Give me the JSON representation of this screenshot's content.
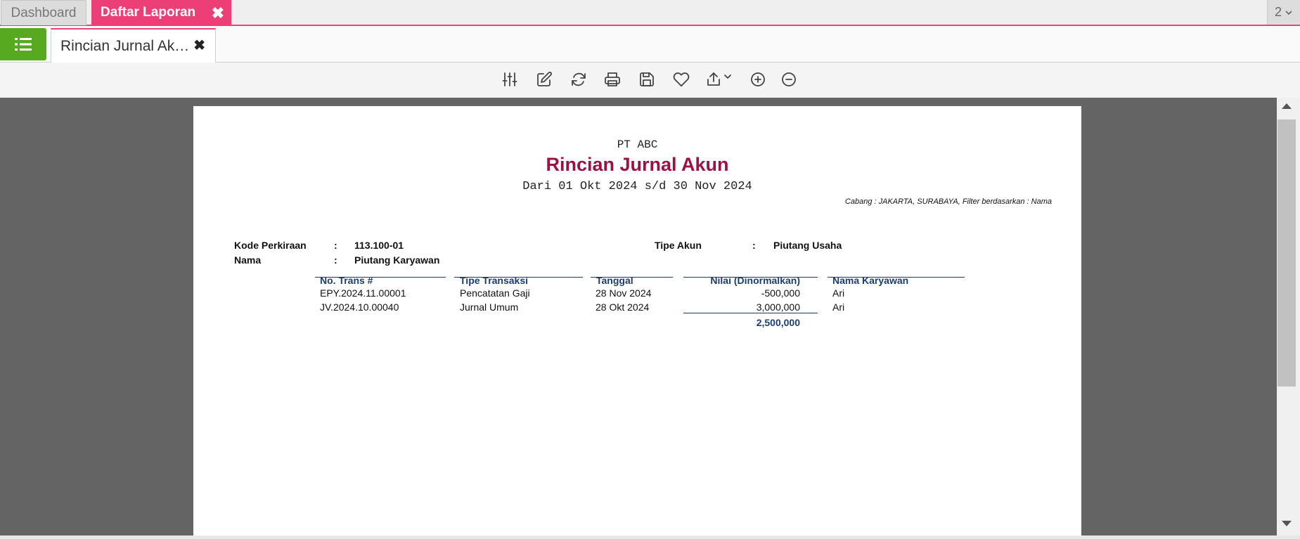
{
  "tabs": {
    "dashboard": "Dashboard",
    "daftar_laporan": "Daftar Laporan",
    "close_glyph": "✖",
    "page_count": "2"
  },
  "subtabs": {
    "rincian": "Rincian Jurnal Ak…",
    "close_glyph": "✖"
  },
  "toolbar_icons": [
    "sliders-icon",
    "edit-icon",
    "refresh-icon",
    "print-icon",
    "save-icon",
    "favorite-icon",
    "export-icon",
    "zoom-in-icon",
    "zoom-out-icon"
  ],
  "report": {
    "company": "PT ABC",
    "title": "Rincian Jurnal Akun",
    "period": "Dari 01 Okt 2024 s/d 30 Nov 2024",
    "filter": "Cabang : JAKARTA, SURABAYA, Filter berdasarkan : Nama",
    "kode_label": "Kode Perkiraan",
    "kode_value": "113.100-01",
    "nama_label": "Nama",
    "nama_value": "Piutang Karyawan",
    "tipe_label": "Tipe Akun",
    "tipe_value": "Piutang Usaha",
    "colon": ":",
    "columns": [
      "No. Trans #",
      "Tipe Transaksi",
      "Tanggal",
      "Nilai (Dinormalkan)",
      "Nama Karyawan"
    ],
    "rows": [
      {
        "no": "EPY.2024.11.00001",
        "tipe": "Pencatatan Gaji",
        "tanggal": "28 Nov 2024",
        "nilai": "-500,000",
        "nama": "Ari"
      },
      {
        "no": "JV.2024.10.00040",
        "tipe": "Jurnal Umum",
        "tanggal": "28 Okt 2024",
        "nilai": "3,000,000",
        "nama": "Ari"
      }
    ],
    "total": "2,500,000"
  },
  "colors": {
    "accent_pink": "#ed3f77",
    "menu_green": "#57a91f",
    "title_red": "#9b1242",
    "header_blue": "#1a3e6e"
  }
}
